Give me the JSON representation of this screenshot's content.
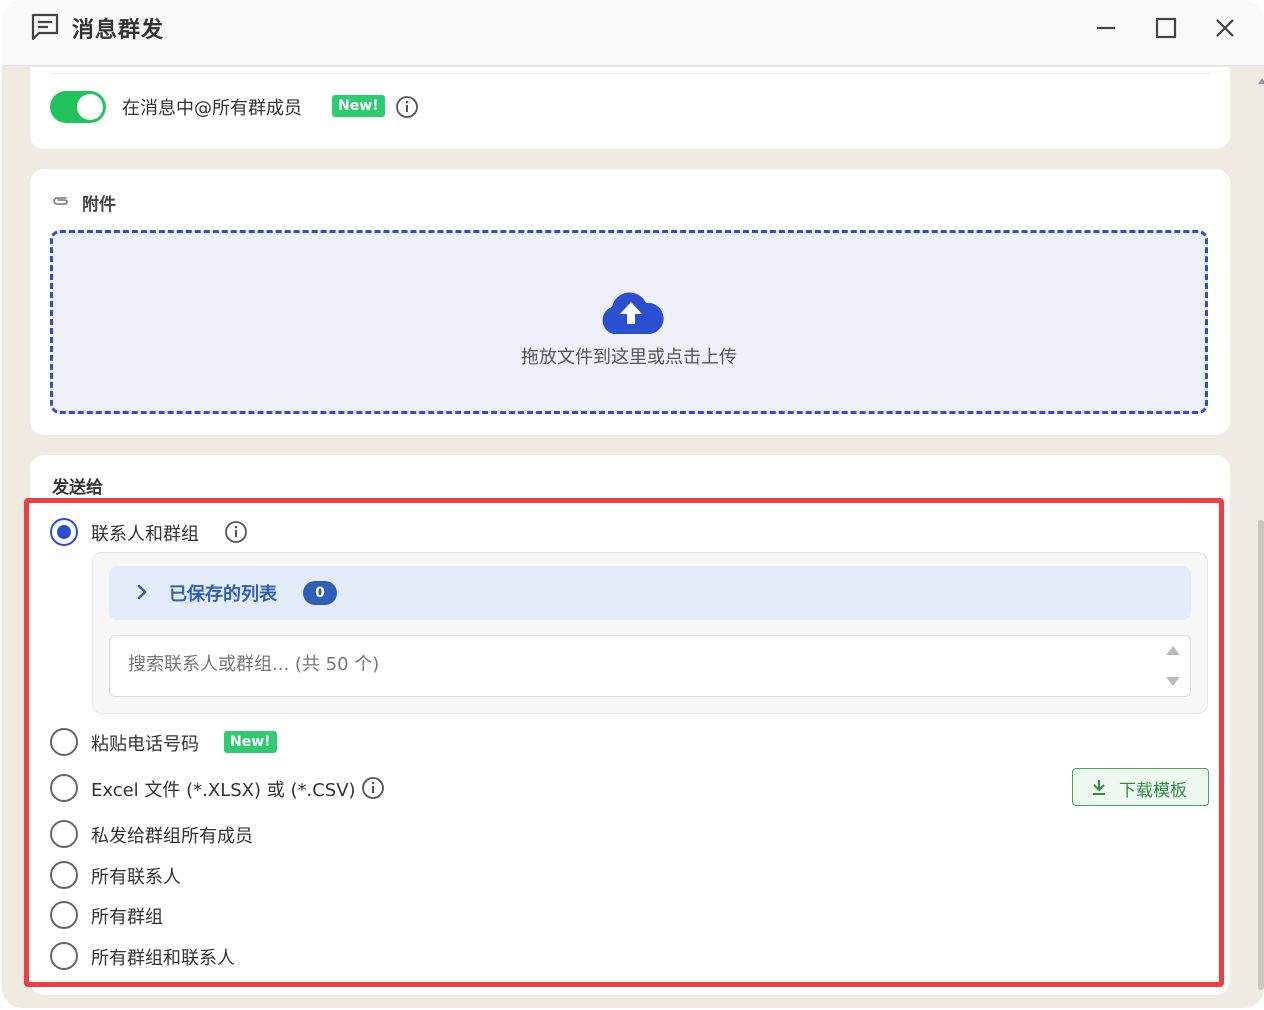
{
  "window": {
    "title": "消息群发",
    "controls": [
      "minimize-icon",
      "maximize-icon",
      "close-icon"
    ]
  },
  "mention": {
    "enabled": true,
    "label": "在消息中@所有群成员",
    "badge": "New!"
  },
  "attachment": {
    "section_label": "附件",
    "dropzone_text": "拖放文件到这里或点击上传"
  },
  "send_to": {
    "section_label": "发送给",
    "options": [
      {
        "label": "联系人和群组",
        "checked": true,
        "info": true
      },
      {
        "label": "粘贴电话号码",
        "checked": false,
        "badge": "New!"
      },
      {
        "label": "Excel 文件 (*.XLSX) 或 (*.CSV)",
        "checked": false,
        "info": true
      },
      {
        "label": "私发给群组所有成员",
        "checked": false
      },
      {
        "label": "所有联系人",
        "checked": false
      },
      {
        "label": "所有群组",
        "checked": false
      },
      {
        "label": "所有群组和联系人",
        "checked": false
      }
    ],
    "saved_lists": {
      "label": "已保存的列表",
      "count": "0"
    },
    "search": {
      "placeholder": "搜索联系人或群组... (共 50 个)",
      "value": ""
    },
    "download_template_label": "下载模板"
  },
  "colors": {
    "accent_blue": "#2b4fd1",
    "toggle_green": "#22c35a",
    "badge_green": "#2ecc71",
    "highlight_red": "#ee3e45"
  }
}
